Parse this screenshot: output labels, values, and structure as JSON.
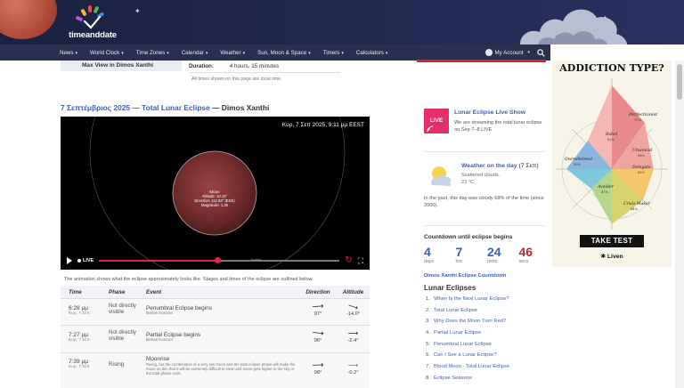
{
  "brand": {
    "name": "timeanddate"
  },
  "nav": {
    "items": [
      "News",
      "World Clock",
      "Time Zones",
      "Calendar",
      "Weather",
      "Sun, Moon & Space",
      "Timers",
      "Calculators"
    ],
    "account": "My Account"
  },
  "summary": {
    "max_view_label": "Max View in Dimos Xanthi",
    "duration_label": "Duration:",
    "duration_value": "4 hours, 15 minutes",
    "times_note": "All times shown on this page are local time."
  },
  "event": {
    "date_title": "7 Σεπτέμβριος 2025 — Total Lunar Eclipse",
    "location": " — Dimos Xanthi"
  },
  "animation": {
    "timestamp": "Κυρ, 7 Σεπ 2025, 9:11 μμ EEST",
    "live_label": "LIVE",
    "moon_label": "Moon",
    "moon_altitude": "Altitude: 10.16°",
    "moon_direction": "Direction: 112.83° (ESE)",
    "moon_magnitude": "Magnitude: 1.36",
    "scrub_label": "Totality",
    "progress": 0.49,
    "note": "The animation shows what the eclipse approximately looks like. Stages and times of the eclipse are outlined below."
  },
  "table": {
    "headers": [
      "Time",
      "Phase",
      "Event",
      "Direction",
      "Altitude"
    ],
    "rows": [
      {
        "time": "6:28 μμ",
        "date": "Κυρ, 7 Σεπ",
        "phase": "Not directly visible",
        "event": "Penumbral Eclipse begins",
        "sub": "Below horizon",
        "direction": "97°",
        "altitude": "-14.0°"
      },
      {
        "time": "7:27 μμ",
        "date": "Κυρ, 7 Σεπ",
        "phase": "Not directly visible",
        "event": "Partial Eclipse begins",
        "sub": "Below horizon",
        "direction": "96°",
        "altitude": "-2.4°"
      },
      {
        "time": "7:39 μμ",
        "date": "Κυρ, 7 Σεπ",
        "phase": "Rising",
        "event": "Moonrise",
        "sub": "Rising, but the combination of a very low moon and the total eclipse phase will make the moon so dim that it will be extremely difficult to view until moon gets higher in the sky or the total phase ends.",
        "direction": "98°",
        "altitude": "-0.2°"
      }
    ]
  },
  "live_show": {
    "badge": "LIVE",
    "title": "Lunar Eclipse Live Show",
    "text": "We are streaming the total lunar eclipse on Sep 7–8 LIVE"
  },
  "weather": {
    "title": "Weather on the day",
    "date": " (7 Σεπ)",
    "condition": "Scattered clouds.",
    "temp": "23 °C",
    "past": "In the past, this day was cloudy 68% of the time (since 2000)."
  },
  "countdown": {
    "title": "Countdown until eclipse begins",
    "cells": [
      {
        "value": "4",
        "label": "days"
      },
      {
        "value": "7",
        "label": "hrs"
      },
      {
        "value": "24",
        "label": "mins"
      },
      {
        "value": "46",
        "label": "secs"
      }
    ],
    "link": "Dimos Xanthi Eclipse Countdown"
  },
  "lunar_eclipses": {
    "title": "Lunar Eclipses",
    "items": [
      "When Is the Next Lunar Eclipse?",
      "Total Lunar Eclipse",
      "Why Does the Moon Turn Red?",
      "Partial Lunar Eclipse",
      "Penumbral Lunar Eclipse",
      "Can I See a Lunar Eclipse?",
      "Blood Moon - Total Lunar Eclipse",
      "Eclipse Seasons"
    ]
  },
  "ad": {
    "title": "ADDICTION TYPE?",
    "labels": {
      "perfectionist": "Perfectionist",
      "perfectionist_pct": "75%",
      "rebel": "Rebel",
      "rebel_pct": "52%",
      "unwound": "Unwound",
      "unwound_pct": "58%",
      "overwhelmed": "Overwhelmed",
      "overwhelmed_pct": "50%",
      "delegate": "Delegate",
      "delegate_pct": "62%",
      "avoider": "Avoider",
      "avoider_pct": "47%",
      "crisis_maker": "Crisis-Maker",
      "crisis_maker_pct": "64%"
    },
    "cta": "TAKE TEST",
    "brand": "Liven"
  },
  "colors": {
    "header_bg": "#1b2140",
    "nav_bg": "#2b3050",
    "link": "#3b5fc0",
    "accent_red": "#c8282d",
    "live_pink": "#e42f6a",
    "moon": "#8b3a3a"
  }
}
